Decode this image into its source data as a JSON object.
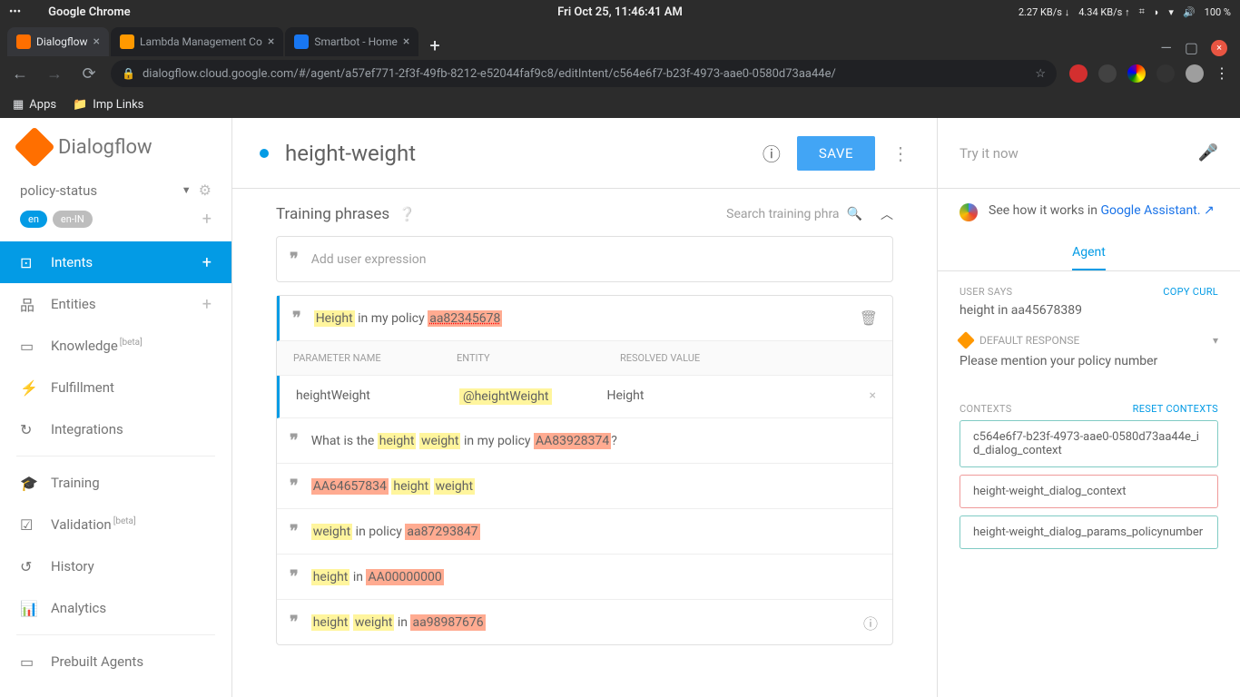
{
  "os": {
    "left_menu": "•••",
    "app_name": "Google Chrome",
    "clock": "Fri Oct 25, 11:46:41 AM",
    "net_down": "2.27 KB/s ↓",
    "net_up": "4.34 KB/s ↑",
    "battery": "100 %"
  },
  "browser": {
    "tabs": [
      {
        "title": "Dialogflow",
        "active": true
      },
      {
        "title": "Lambda Management Co",
        "active": false
      },
      {
        "title": "Smartbot - Home",
        "active": false
      }
    ],
    "url": "dialogflow.cloud.google.com/#/agent/a57ef771-2f3f-49fb-8212-e52044faf9c8/editIntent/c564e6f7-b23f-4973-aae0-0580d73aa44e/",
    "bookmarks": [
      {
        "label": "Apps"
      },
      {
        "label": "Imp Links"
      }
    ]
  },
  "sidebar": {
    "brand": "Dialogflow",
    "agent": "policy-status",
    "langs": [
      "en",
      "en-IN"
    ],
    "nav": [
      {
        "label": "Intents",
        "active": true,
        "add": true
      },
      {
        "label": "Entities",
        "add": true
      },
      {
        "label": "Knowledge",
        "beta": true
      },
      {
        "label": "Fulfillment"
      },
      {
        "label": "Integrations"
      },
      {
        "label": "Training"
      },
      {
        "label": "Validation",
        "beta": true
      },
      {
        "label": "History"
      },
      {
        "label": "Analytics"
      },
      {
        "label": "Prebuilt Agents"
      }
    ]
  },
  "intent": {
    "name": "height-weight",
    "save": "SAVE",
    "section_title": "Training phrases",
    "search_ph": "Search training phra",
    "add_ph": "Add user expression",
    "param_headers": [
      "PARAMETER NAME",
      "ENTITY",
      "RESOLVED VALUE"
    ],
    "param": {
      "name": "heightWeight",
      "entity": "@heightWeight",
      "resolved": "Height"
    }
  },
  "phrases": {
    "p1": {
      "a": "Height",
      "b": " in my policy ",
      "c": "aa82345678"
    },
    "p2": {
      "a": "What is the ",
      "b": "height",
      "c": " ",
      "d": "weight",
      "e": " in my policy ",
      "f": "AA83928374",
      "g": "?"
    },
    "p3": {
      "a": "AA64657834",
      "b": " ",
      "c": "height",
      "d": " ",
      "e": "weight"
    },
    "p4": {
      "a": "weight",
      "b": " in policy ",
      "c": "aa87293847"
    },
    "p5": {
      "a": "height",
      "b": " in ",
      "c": "AA00000000"
    },
    "p6": {
      "a": "height",
      "b": " ",
      "c": "weight",
      "d": " in ",
      "e": "aa98987676"
    }
  },
  "right": {
    "try": "Try it now",
    "assistant_text": "See how it works in ",
    "assistant_link": "Google Assistant.",
    "tab": "Agent",
    "user_says_lbl": "USER SAYS",
    "copy_curl": "COPY CURL",
    "user_says": "height in aa45678389",
    "default_response": "DEFAULT RESPONSE",
    "response_text": "Please mention your policy number",
    "contexts_lbl": "CONTEXTS",
    "reset_contexts": "RESET CONTEXTS",
    "contexts": [
      "c564e6f7-b23f-4973-aae0-0580d73aa44e_id_dialog_context",
      "height-weight_dialog_context",
      "height-weight_dialog_params_policynumber"
    ]
  }
}
